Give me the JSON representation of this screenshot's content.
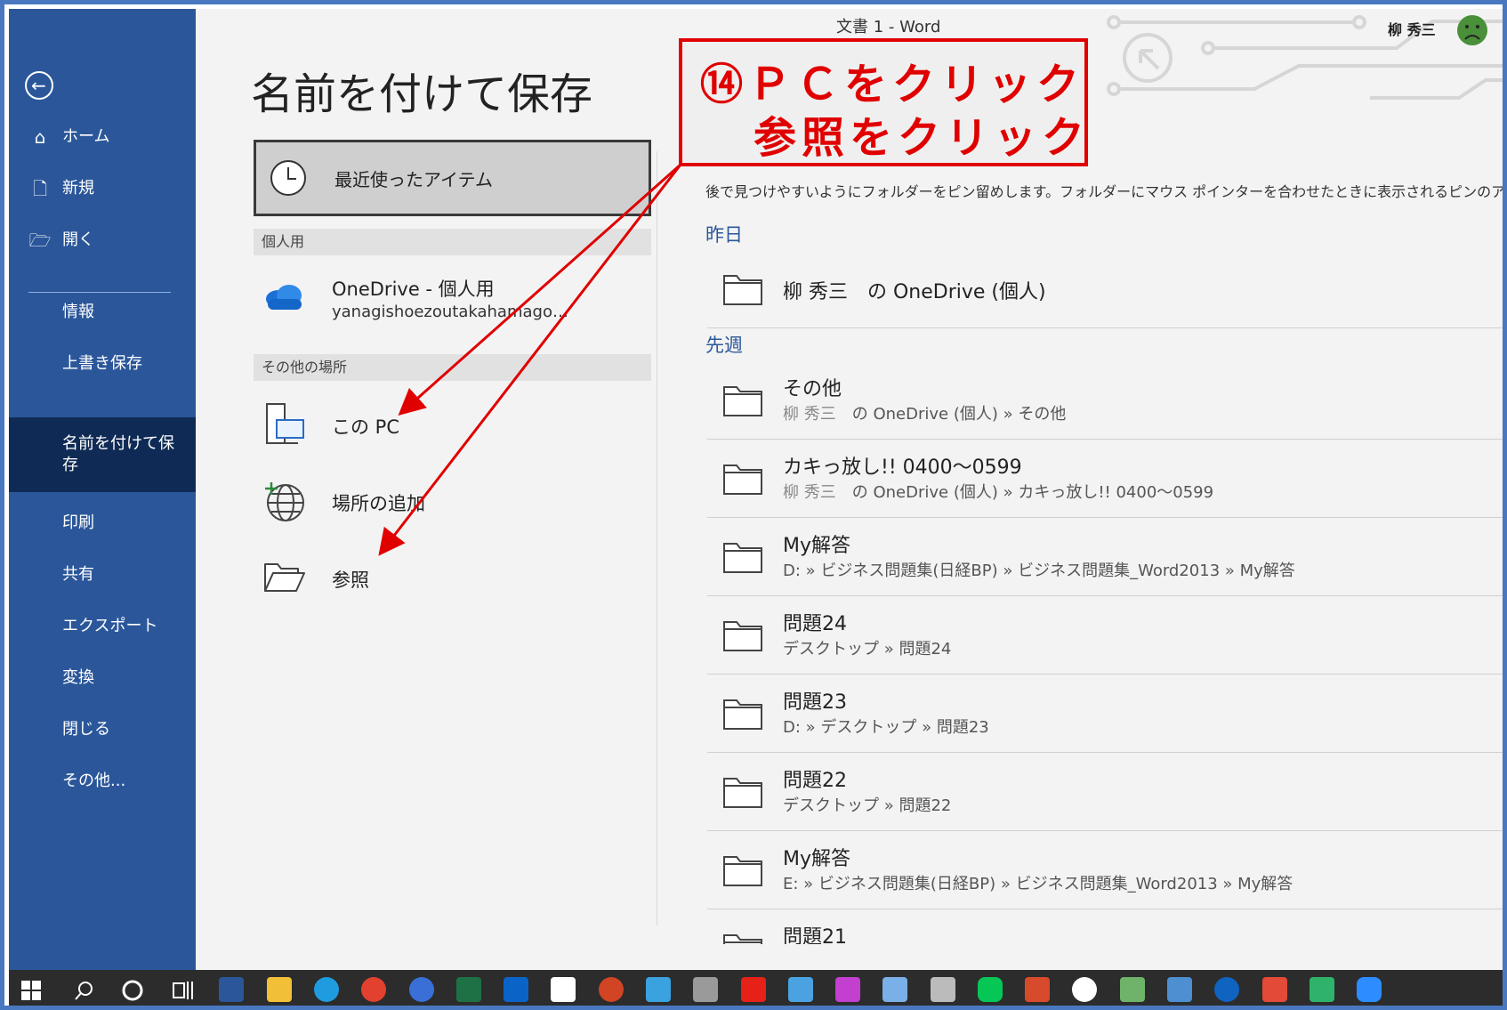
{
  "window": {
    "title": "文書 1  -  Word",
    "user": "柳 秀三"
  },
  "sidebar": {
    "items": [
      {
        "label": "ホーム",
        "icon": "home-icon"
      },
      {
        "label": "新規",
        "icon": "new-document-icon"
      },
      {
        "label": "開く",
        "icon": "open-folder-icon"
      },
      {
        "label": "情報"
      },
      {
        "label": "上書き保存"
      },
      {
        "label": "名前を付けて保存"
      },
      {
        "label": "印刷"
      },
      {
        "label": "共有"
      },
      {
        "label": "エクスポート"
      },
      {
        "label": "変換"
      },
      {
        "label": "閉じる"
      },
      {
        "label": "その他..."
      }
    ],
    "selected": "名前を付けて保存"
  },
  "page": {
    "heading": "名前を付けて保存"
  },
  "locations": {
    "recent": "最近使ったアイテム",
    "personal_header": "個人用",
    "onedrive_name": "OneDrive - 個人用",
    "onedrive_account": "yanagishoezoutakahamago…",
    "other_header": "その他の場所",
    "this_pc": "この PC",
    "add_place": "場所の追加",
    "browse": "参照"
  },
  "callout": {
    "line1": "⑭ＰＣをクリック",
    "line2": "参照をクリック",
    "color": "#e00000"
  },
  "recent": {
    "hint": "後で見つけやすいようにフォルダーをピン留めします。フォルダーにマウス ポインターを合わせたときに表示されるピンのアイコンをク",
    "yesterday_label": "昨日",
    "yesterday": [
      {
        "name": "柳 秀三　の OneDrive (個人)"
      }
    ],
    "lastweek_label": "先週",
    "lastweek": [
      {
        "name": "その他",
        "owner": "柳 秀三",
        "path": "の OneDrive (個人) » その他"
      },
      {
        "name": "カキっ放し!! 0400～0599",
        "owner": "柳 秀三",
        "path": "の OneDrive (個人) » カキっ放し!! 0400～0599"
      },
      {
        "name": "My解答",
        "owner": "",
        "path": "D: » ビジネス問題集(日経BP) » ビジネス問題集_Word2013 » My解答"
      },
      {
        "name": "問題24",
        "owner": "",
        "path": "デスクトップ » 問題24"
      },
      {
        "name": "問題23",
        "owner": "",
        "path": "D: » デスクトップ » 問題23"
      },
      {
        "name": "問題22",
        "owner": "",
        "path": "デスクトップ » 問題22"
      },
      {
        "name": "My解答",
        "owner": "",
        "path": "E: » ビジネス問題集(日経BP) » ビジネス問題集_Word2013 » My解答"
      },
      {
        "name": "問題21",
        "owner": "",
        "path": ""
      }
    ]
  },
  "colors": {
    "sidebar": "#2b579a",
    "selected": "#0f2b55",
    "accent": "#2b579a",
    "taskbar": "#2c2c2c"
  }
}
